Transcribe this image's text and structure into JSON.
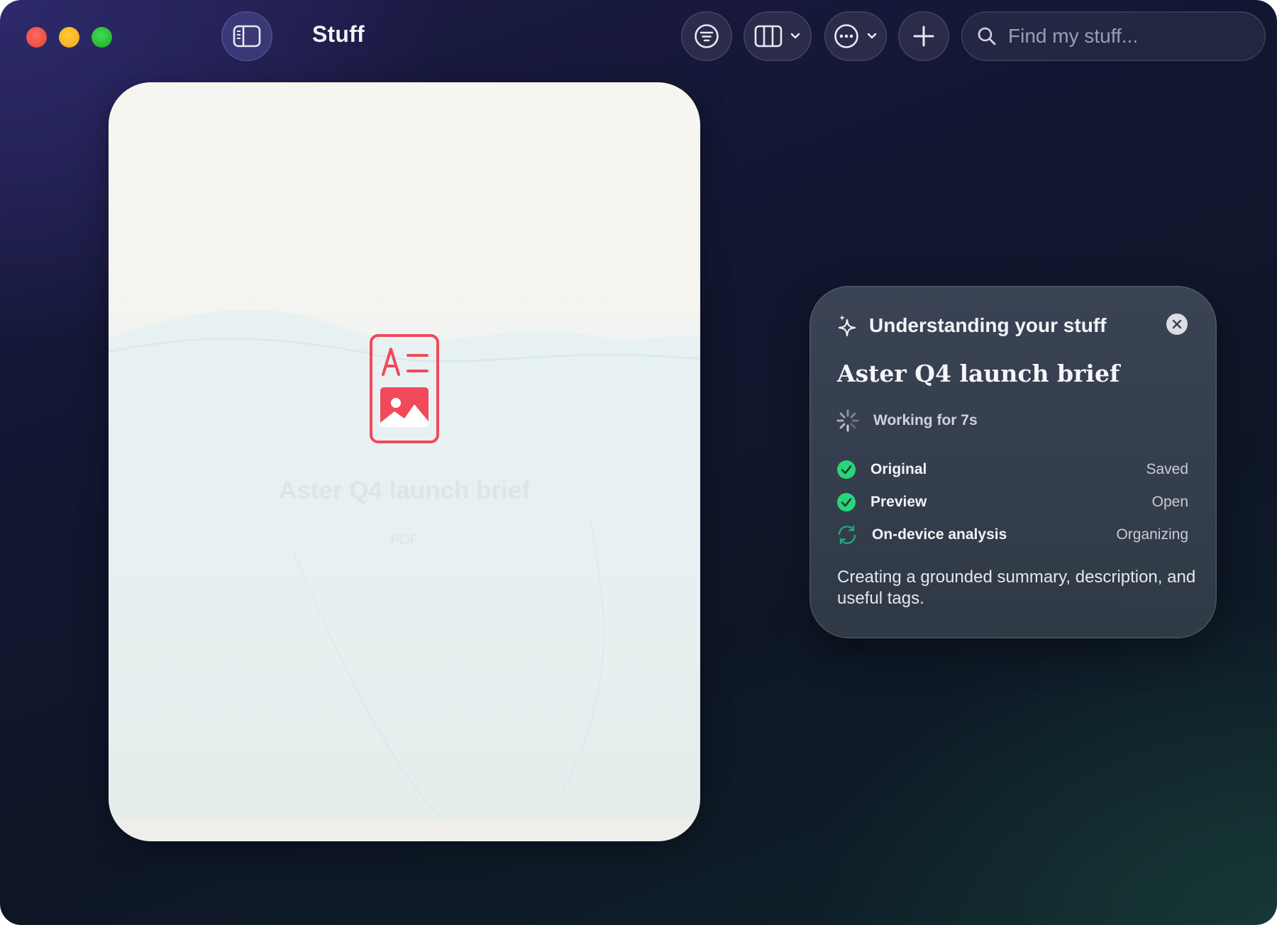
{
  "window": {
    "title": "Stuff"
  },
  "toolbar": {
    "sidebar_icon": "sidebar-icon",
    "filter_icon": "filter-icon",
    "view_icon": "columns-icon",
    "more_icon": "ellipsis-circle-icon",
    "add_icon": "plus-icon"
  },
  "search": {
    "placeholder": "Find my stuff..."
  },
  "document": {
    "title": "Aster Q4 launch brief",
    "type": "PDF",
    "icon": "document-icon",
    "icon_color": "#f04a5a"
  },
  "panel": {
    "header": "Understanding your stuff",
    "doc_title": "Aster Q4 launch brief",
    "working": "Working for 7s",
    "steps": [
      {
        "label": "Original",
        "status": "Saved",
        "state": "done"
      },
      {
        "label": "Preview",
        "status": "Open",
        "state": "done"
      },
      {
        "label": "On-device analysis",
        "status": "Organizing",
        "state": "in-progress"
      }
    ],
    "description": "Creating a grounded summary, description, and useful tags.",
    "accent_color": "#27d67a"
  }
}
